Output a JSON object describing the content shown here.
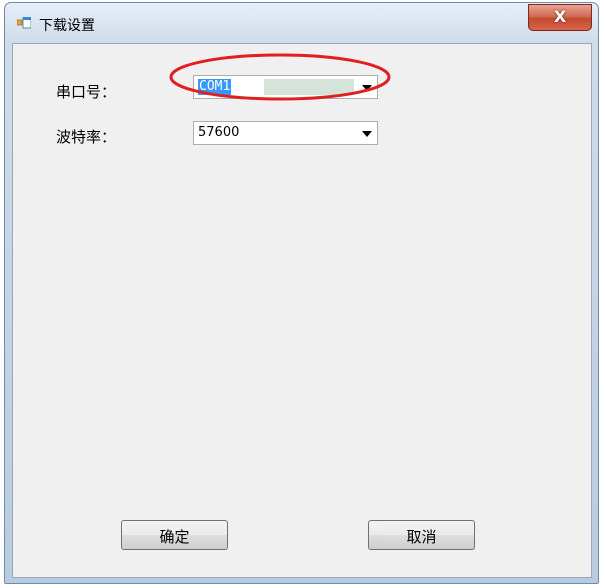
{
  "window": {
    "title": "下载设置",
    "icon": "app-window-icon",
    "close_label": "X"
  },
  "form": {
    "port_label": "串口号：",
    "port_value": "COM1",
    "baud_label": "波特率：",
    "baud_value": "57600"
  },
  "buttons": {
    "ok_label": "确定",
    "cancel_label": "取消"
  },
  "colors": {
    "highlight": "#e01f1f",
    "selection": "#3399ff"
  }
}
